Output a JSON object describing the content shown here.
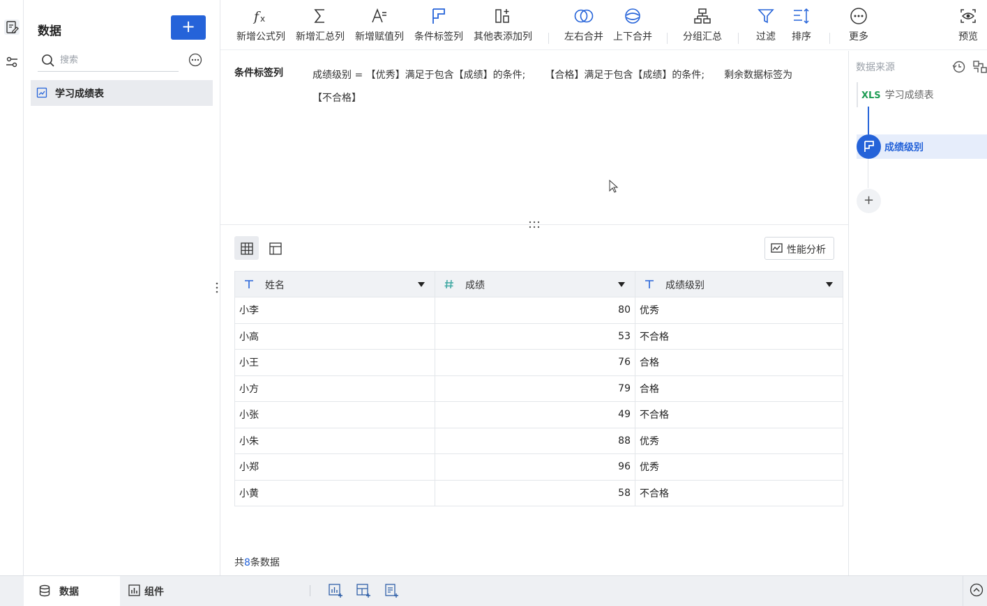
{
  "left_panel": {
    "title": "数据",
    "add_label": "+",
    "search_placeholder": "搜索",
    "dataset_name": "学习成绩表"
  },
  "toolbar": {
    "items": [
      {
        "label": "新增公式列",
        "icon": "formula-icon"
      },
      {
        "label": "新增汇总列",
        "icon": "sigma-icon"
      },
      {
        "label": "新增赋值列",
        "icon": "assign-icon"
      },
      {
        "label": "条件标签列",
        "icon": "flag-icon"
      },
      {
        "label": "其他表添加列",
        "icon": "add-column-icon"
      },
      {
        "label": "左右合并",
        "icon": "horizontal-merge-icon"
      },
      {
        "label": "上下合并",
        "icon": "vertical-merge-icon"
      },
      {
        "label": "分组汇总",
        "icon": "group-icon"
      },
      {
        "label": "过滤",
        "icon": "filter-icon"
      },
      {
        "label": "排序",
        "icon": "sort-icon"
      },
      {
        "label": "更多",
        "icon": "more-icon"
      },
      {
        "label": "预览",
        "icon": "eye-icon"
      }
    ]
  },
  "config": {
    "label": "条件标签列",
    "part1": "成绩级别 = 【优秀】满足于包含【成绩】的条件;",
    "part2": "【合格】满足于包含【成绩】的条件;",
    "part3": "剩余数据标签为",
    "part4": "【不合格】"
  },
  "preview": {
    "perf_label": "性能分析",
    "columns": [
      {
        "name": "姓名",
        "type": "T"
      },
      {
        "name": "成绩",
        "type": "#"
      },
      {
        "name": "成绩级别",
        "type": "T"
      }
    ],
    "rows": [
      [
        "小李",
        "80",
        "优秀"
      ],
      [
        "小高",
        "53",
        "不合格"
      ],
      [
        "小王",
        "76",
        "合格"
      ],
      [
        "小方",
        "79",
        "合格"
      ],
      [
        "小张",
        "49",
        "不合格"
      ],
      [
        "小朱",
        "88",
        "优秀"
      ],
      [
        "小郑",
        "96",
        "优秀"
      ],
      [
        "小黄",
        "58",
        "不合格"
      ]
    ],
    "count_prefix": "共",
    "count": "8",
    "count_suffix": "条数据"
  },
  "right_panel": {
    "title": "数据来源",
    "source_badge": "XLS",
    "source_name": "学习成绩表",
    "node_name": "成绩级别",
    "add_label": "+"
  },
  "bottom": {
    "tab_data": "数据",
    "tab_components": "组件"
  },
  "colors": {
    "primary": "#2563d9",
    "xls_green": "#1f9d55",
    "number_type": "#3aa6a0"
  }
}
